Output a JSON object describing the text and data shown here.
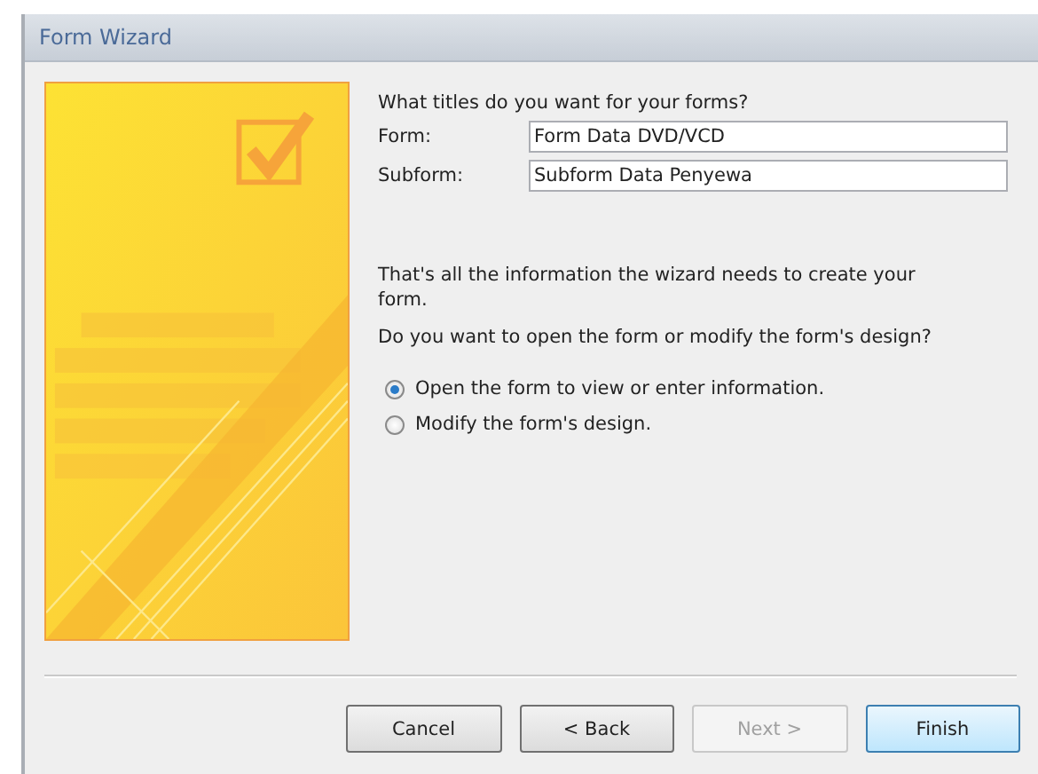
{
  "window": {
    "title": "Form Wizard"
  },
  "prompt": "What titles do you want for your forms?",
  "fields": [
    {
      "label": "Form:",
      "value": "Form Data DVD/VCD"
    },
    {
      "label": "Subform:",
      "value": "Subform Data Penyewa"
    }
  ],
  "info": "That's all the information the wizard needs to create your form.",
  "question": "Do you want to open the form or modify the form's design?",
  "options": [
    {
      "label": "Open the form to view or enter information.",
      "selected": true
    },
    {
      "label": "Modify the form's design.",
      "selected": false
    }
  ],
  "buttons": [
    {
      "label": "Cancel",
      "disabled": false,
      "default": false
    },
    {
      "label": "< Back",
      "disabled": false,
      "default": false
    },
    {
      "label": "Next >",
      "disabled": true,
      "default": false
    },
    {
      "label": "Finish",
      "disabled": false,
      "default": true
    }
  ]
}
